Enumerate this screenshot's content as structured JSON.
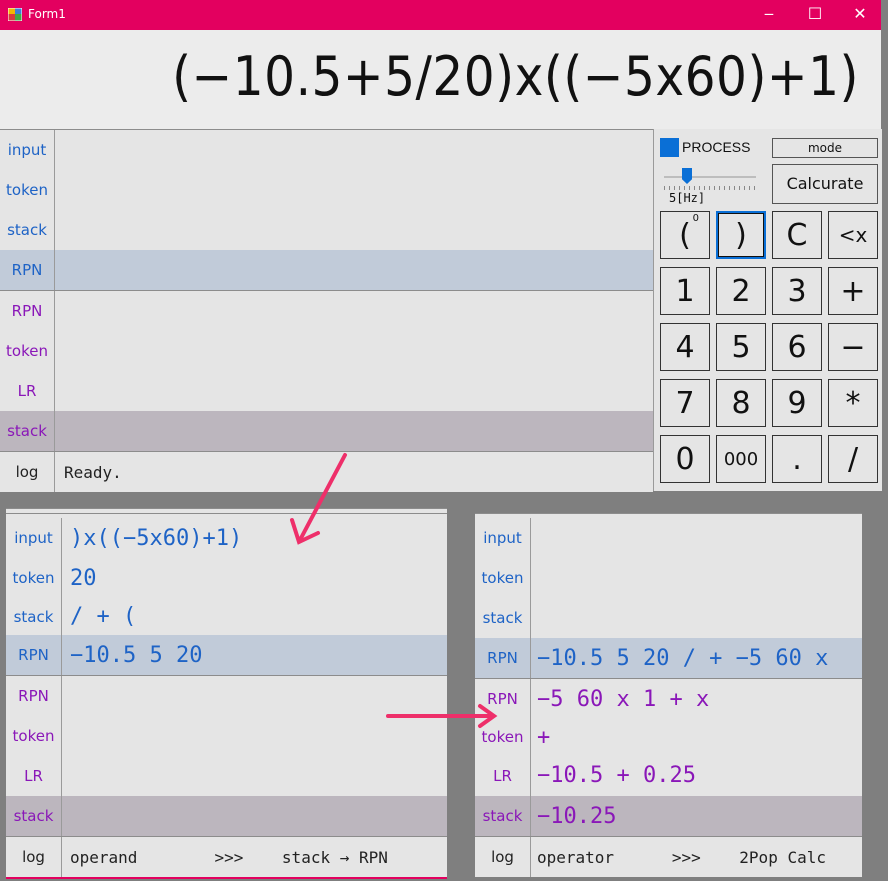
{
  "window": {
    "title": "Form1",
    "controls": {
      "minimize": "‒",
      "maximize": "☐",
      "close": "✕"
    },
    "accent_color": "#e3005f"
  },
  "expression": "(−10.5+5/20)x((−5x60)+1)",
  "main_grid": {
    "rows": [
      {
        "label": "input",
        "value": ""
      },
      {
        "label": "token",
        "value": ""
      },
      {
        "label": "stack",
        "value": ""
      },
      {
        "label": "RPN",
        "value": ""
      },
      {
        "label": "RPN",
        "value": ""
      },
      {
        "label": "token",
        "value": ""
      },
      {
        "label": "LR",
        "value": ""
      },
      {
        "label": "stack",
        "value": ""
      },
      {
        "label": "log",
        "value": "Ready."
      }
    ]
  },
  "controls": {
    "process_label": "PROCESS",
    "mode_label": "mode",
    "calculate_label": "Calcurate",
    "frequency_label": "5[Hz]",
    "frequency_level": 5,
    "keypad": [
      {
        "label": "(",
        "sup": "0"
      },
      {
        "label": ")"
      },
      {
        "label": "C"
      },
      {
        "label": "<x"
      },
      {
        "label": "1"
      },
      {
        "label": "2"
      },
      {
        "label": "3"
      },
      {
        "label": "+"
      },
      {
        "label": "4"
      },
      {
        "label": "5"
      },
      {
        "label": "6"
      },
      {
        "label": "−"
      },
      {
        "label": "7"
      },
      {
        "label": "8"
      },
      {
        "label": "9"
      },
      {
        "label": "*"
      },
      {
        "label": "0"
      },
      {
        "label": "000"
      },
      {
        "label": "."
      },
      {
        "label": "/"
      }
    ]
  },
  "panel_left": {
    "rows": [
      {
        "label": "input",
        "value": ")x((−5x60)+1)"
      },
      {
        "label": "token",
        "value": "20"
      },
      {
        "label": "stack",
        "value": "/ + ("
      },
      {
        "label": "RPN",
        "value": "−10.5 5 20"
      },
      {
        "label": "RPN",
        "value": ""
      },
      {
        "label": "token",
        "value": ""
      },
      {
        "label": "LR",
        "value": ""
      },
      {
        "label": "stack",
        "value": ""
      },
      {
        "label": "log",
        "value": "operand        >>>    stack → RPN"
      }
    ]
  },
  "panel_right": {
    "rows": [
      {
        "label": "input",
        "value": ""
      },
      {
        "label": "token",
        "value": ""
      },
      {
        "label": "stack",
        "value": ""
      },
      {
        "label": "RPN",
        "value": "−10.5 5 20 / + −5 60 x"
      },
      {
        "label": "RPN",
        "value": "−5 60 x 1 + x"
      },
      {
        "label": "token",
        "value": "+"
      },
      {
        "label": "LR",
        "value": "−10.5 + 0.25"
      },
      {
        "label": "stack",
        "value": "−10.25"
      },
      {
        "label": "log",
        "value": "operator      >>>    2Pop Calc"
      }
    ]
  }
}
